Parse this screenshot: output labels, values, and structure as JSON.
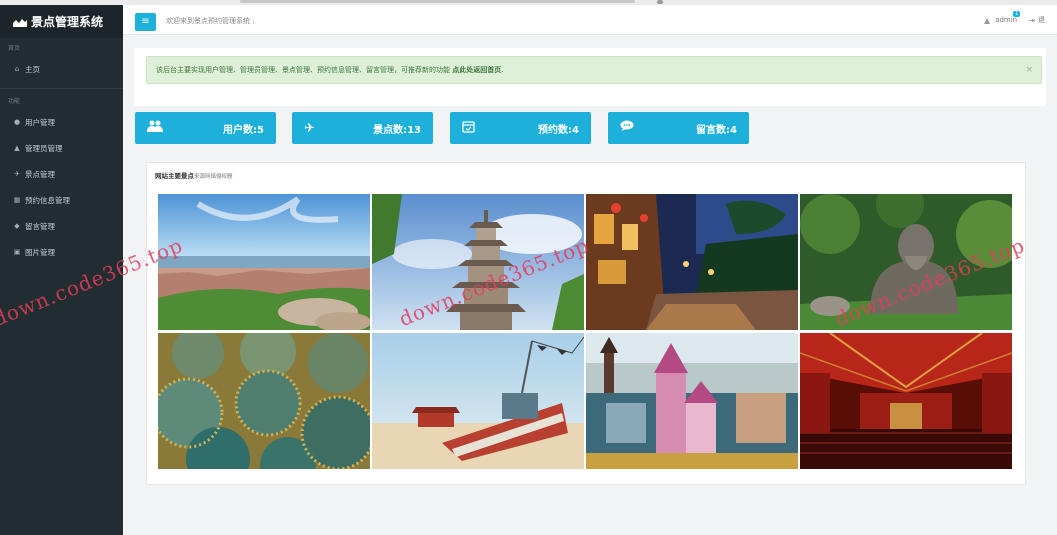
{
  "app": {
    "brand": "景点管理系统"
  },
  "sidebar": {
    "sections": [
      {
        "label": "首页",
        "items": [
          {
            "label": "主页",
            "icon": "home-icon"
          }
        ]
      },
      {
        "label": "功能",
        "items": [
          {
            "label": "用户管理",
            "icon": "users-icon"
          },
          {
            "label": "管理员管理",
            "icon": "user-icon"
          },
          {
            "label": "景点管理",
            "icon": "plane-icon"
          },
          {
            "label": "预约信息管理",
            "icon": "calendar-icon"
          },
          {
            "label": "留言管理",
            "icon": "comment-icon"
          },
          {
            "label": "图片管理",
            "icon": "image-icon"
          }
        ]
      }
    ]
  },
  "header": {
    "menu_icon": "≡",
    "welcome": "欢迎来到景点预约管理系统 ;",
    "username": "admin",
    "notification_count": "1",
    "logout_label": "退"
  },
  "alert": {
    "text": "该后台主要实现用户管理、管理员管理、景点管理、预约信息管理、留言管理，可推荐新的功能 ",
    "link": "点此处返回首页",
    "link_suffix": "."
  },
  "stats": [
    {
      "label": "用户数:5",
      "icon": "users-icon"
    },
    {
      "label": "景点数:13",
      "icon": "plane-icon"
    },
    {
      "label": "预约数:4",
      "icon": "calendar-check-icon"
    },
    {
      "label": "留言数:4",
      "icon": "comment-icon"
    }
  ],
  "gallery": {
    "title": "网站主要景点",
    "subtitle": "来源网络侵权删"
  },
  "watermark": "down.code365.top",
  "colors": {
    "sidebar": "#222d32",
    "accent": "#1cb0da",
    "alert_bg": "#dff0d8"
  }
}
